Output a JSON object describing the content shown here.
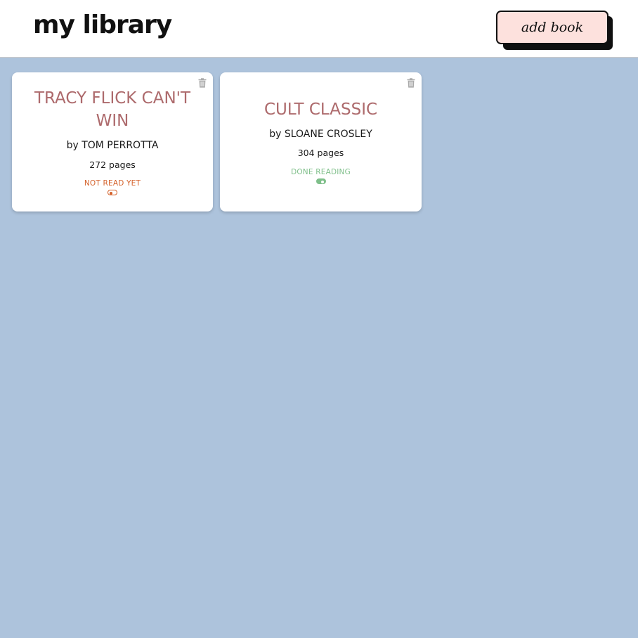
{
  "header": {
    "logo": "my library",
    "add_button_label": "add book"
  },
  "books": [
    {
      "title": "TRACY FLICK CAN'T WIN",
      "author": "by TOM PERROTTA",
      "pages": "272 pages",
      "status": "NOT READ YET",
      "read": false
    },
    {
      "title": "CULT CLASSIC",
      "author": "by SLOANE CROSLEY",
      "pages": "304 pages",
      "status": "DONE READING",
      "read": true
    }
  ],
  "icons": {
    "delete": "trash-icon",
    "toggle": "toggle-icon"
  },
  "colors": {
    "background": "#adc3dc",
    "title": "#ad6a6c",
    "not_read": "#d4612a",
    "done_reading": "#7fbf8a",
    "button_fill": "#fde1dd"
  }
}
